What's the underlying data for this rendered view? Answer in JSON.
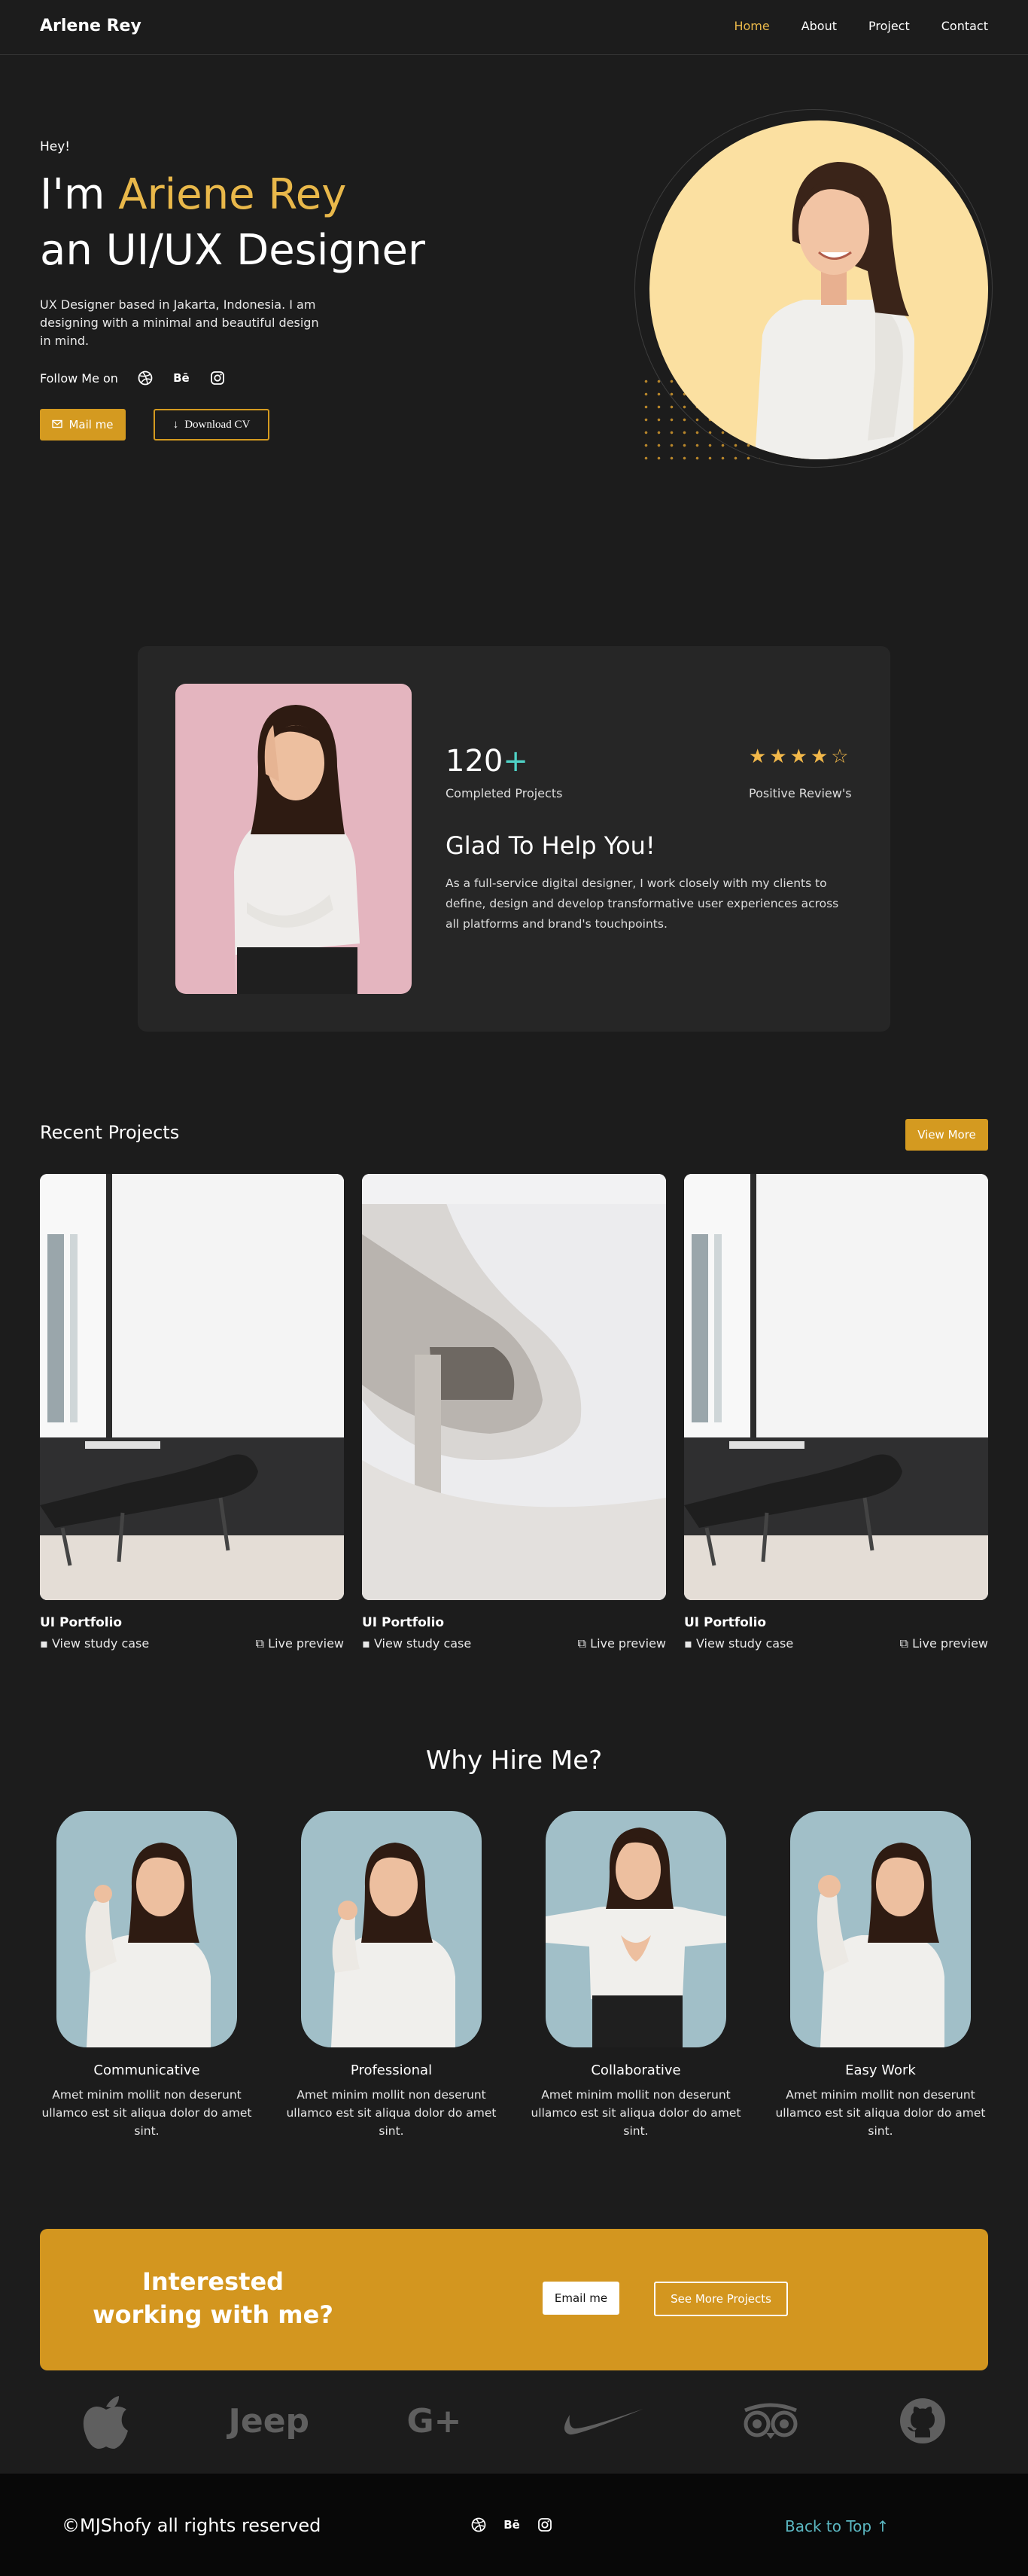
{
  "nav": {
    "brand": "Arlene Rey",
    "links": [
      "Home",
      "About",
      "Project",
      "Contact"
    ]
  },
  "hero": {
    "greeting": "Hey!",
    "title_prefix": "I'm ",
    "title_name": "Ariene Rey",
    "title_line2": "an UI/UX Designer",
    "description": "UX Designer based in Jakarta, Indonesia. I am designing with a minimal and beautiful design in mind.",
    "follow_label": "Follow Me on",
    "mail_button": "Mail me",
    "cv_button": "Download CV"
  },
  "stats": {
    "projects_number": "120",
    "projects_plus": "+",
    "projects_label": "Completed Projects",
    "reviews_label": "Positive Review's",
    "rating": 4,
    "rating_max": 5,
    "heading": "Glad To Help You!",
    "description": "As a full-service digital designer, I work closely with my clients to define, design and develop transformative user experiences across all platforms and brand's touchpoints."
  },
  "projects": {
    "title": "Recent Projects",
    "view_more": "View More",
    "items": [
      {
        "title": "UI Portfolio",
        "study": "View study case",
        "preview": "Live preview"
      },
      {
        "title": "UI Portfolio",
        "study": "View study case",
        "preview": "Live preview"
      },
      {
        "title": "UI Portfolio",
        "study": "View study case",
        "preview": "Live preview"
      }
    ]
  },
  "hire": {
    "title": "Why Hire Me?",
    "items": [
      {
        "title": "Communicative",
        "desc": "Amet minim mollit non deserunt ullamco est sit aliqua dolor do amet sint."
      },
      {
        "title": "Professional",
        "desc": "Amet minim mollit non deserunt ullamco est sit aliqua dolor do amet sint."
      },
      {
        "title": "Collaborative",
        "desc": "Amet minim mollit non deserunt ullamco est sit aliqua dolor do amet sint."
      },
      {
        "title": "Easy Work",
        "desc": "Amet minim mollit non deserunt ullamco est sit aliqua dolor do amet sint."
      }
    ]
  },
  "cta": {
    "title": "Interested working with me?",
    "email_button": "Email me",
    "projects_button": "See More Projects"
  },
  "logos": {
    "jeep": "Jeep",
    "google_plus": "G+"
  },
  "footer": {
    "copyright": "©MJShofy all rights reserved",
    "back_to_top": "Back to Top ↑"
  },
  "colors": {
    "accent": "#d49a20",
    "accent_text": "#e9b84a",
    "background": "#1c1c1c",
    "card": "#262626",
    "teal": "#4fd1c5"
  }
}
